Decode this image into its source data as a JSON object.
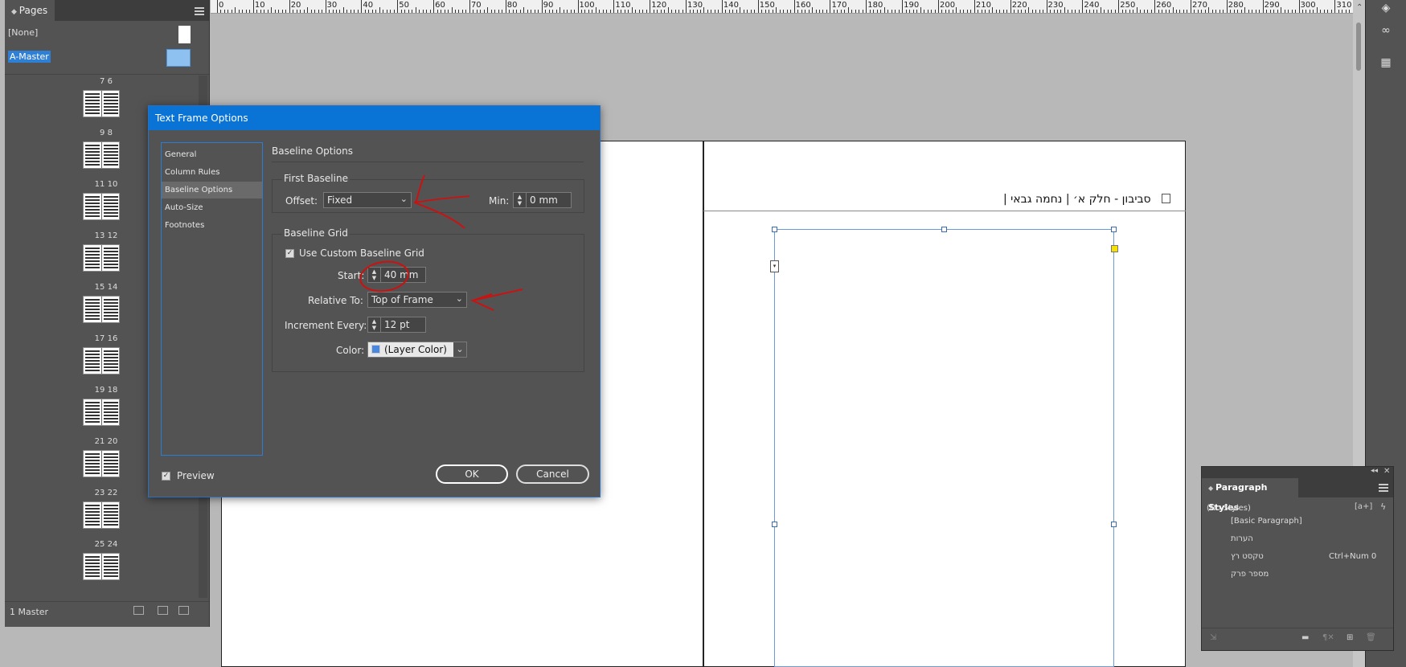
{
  "ruler": {
    "ticks": [
      "0",
      "10",
      "20",
      "30",
      "40",
      "50",
      "60",
      "70",
      "80",
      "90",
      "100",
      "110",
      "120",
      "130",
      "140",
      "150",
      "160",
      "170",
      "180",
      "190",
      "200",
      "210",
      "220",
      "230",
      "240",
      "250",
      "260",
      "270",
      "280",
      "290",
      "300",
      "310"
    ]
  },
  "pages_panel": {
    "tab_label": "Pages",
    "none_label": "[None]",
    "master_label": "A-Master",
    "spreads": [
      "7 6",
      "9 8",
      "11 10",
      "13 12",
      "15 14",
      "17 16",
      "19 18",
      "21 20",
      "23 22",
      "25 24"
    ],
    "footer_count": "1 Master"
  },
  "document": {
    "header_text": "סביבון - חלק א׳  |  נחמה גבאי  |"
  },
  "paragraph_styles": {
    "tab_label": "Paragraph Styles",
    "current": "(No Styles)",
    "items": [
      {
        "label": "[Basic Paragraph]",
        "shortcut": ""
      },
      {
        "label": "הערות",
        "shortcut": ""
      },
      {
        "label": "טקסט רץ",
        "shortcut": "Ctrl+Num 0"
      },
      {
        "label": "מספר פרק",
        "shortcut": ""
      }
    ]
  },
  "dialog": {
    "title": "Text Frame Options",
    "nav": [
      "General",
      "Column Rules",
      "Baseline Options",
      "Auto-Size",
      "Footnotes"
    ],
    "active_nav": "Baseline Options",
    "section_title": "Baseline Options",
    "first_baseline": {
      "title": "First Baseline",
      "offset_label": "Offset:",
      "offset_value": "Fixed",
      "min_label": "Min:",
      "min_value": "0 mm"
    },
    "baseline_grid": {
      "title": "Baseline Grid",
      "use_custom_label": "Use Custom Baseline Grid",
      "use_custom_checked": true,
      "start_label": "Start:",
      "start_value": "40 mm",
      "relative_label": "Relative To:",
      "relative_value": "Top of Frame",
      "increment_label": "Increment Every:",
      "increment_value": "12 pt",
      "color_label": "Color:",
      "color_value": "(Layer Color)",
      "color_swatch": "#4a88e0"
    },
    "preview_label": "Preview",
    "preview_checked": true,
    "ok_label": "OK",
    "cancel_label": "Cancel"
  },
  "colors": {
    "panel_bg": "#535353",
    "title_bar": "#0a74d6",
    "selection": "#2f7fd4",
    "annotation": "#cc1111"
  }
}
